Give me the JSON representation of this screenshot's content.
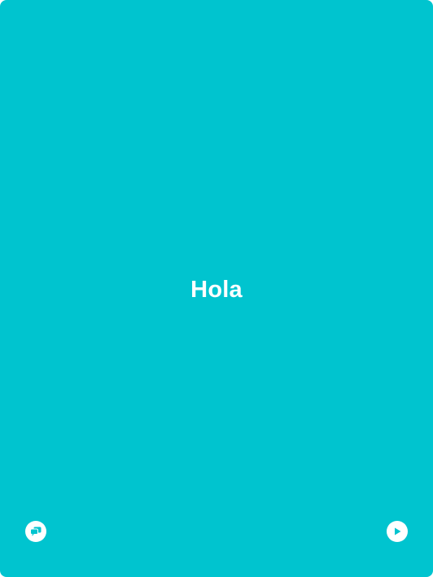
{
  "card": {
    "word": "Hola",
    "background_color": "#00c4cf",
    "foreground_color": "#ffffff"
  },
  "controls": {
    "left_icon": "chat-bubbles-icon",
    "right_icon": "play-icon"
  }
}
